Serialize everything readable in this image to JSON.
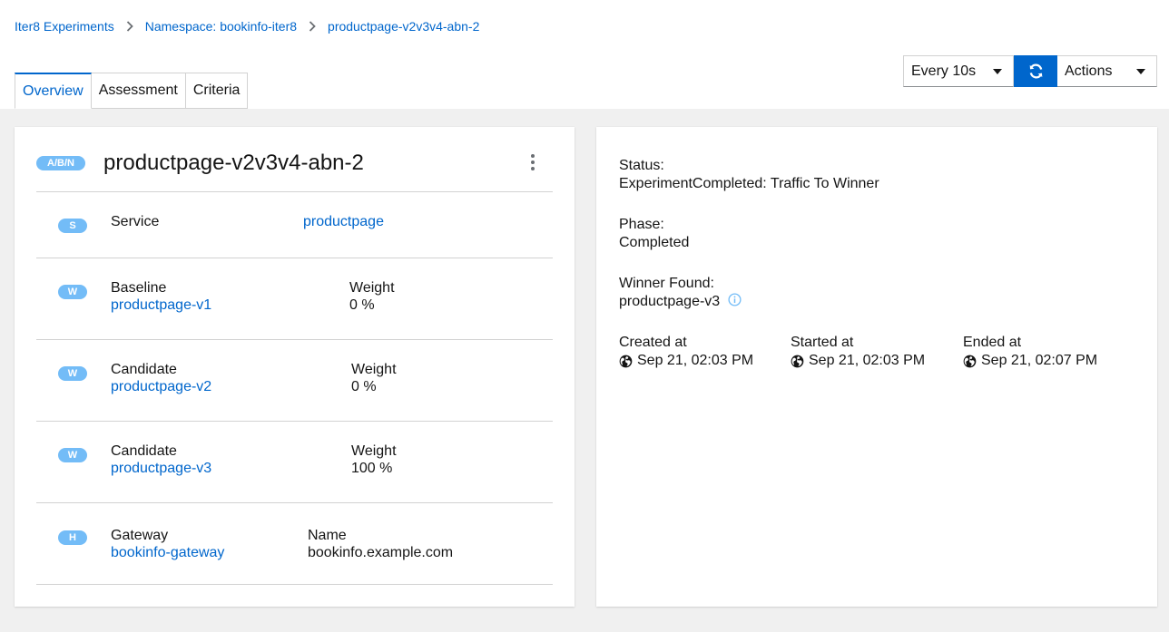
{
  "breadcrumb": [
    "Iter8 Experiments",
    "Namespace: bookinfo-iter8",
    "productpage-v2v3v4-abn-2"
  ],
  "tabs": [
    "Overview",
    "Assessment",
    "Criteria"
  ],
  "toolbar": {
    "interval": "Every 10s",
    "actions": "Actions"
  },
  "experiment": {
    "type_badge": "A/B/N",
    "name": "productpage-v2v3v4-abn-2",
    "service": {
      "badge": "S",
      "label": "Service",
      "value": "productpage"
    },
    "baseline": {
      "badge": "W",
      "label": "Baseline",
      "name": "productpage-v1",
      "weight_label": "Weight",
      "weight": "0 %"
    },
    "candidates": [
      {
        "badge": "W",
        "label": "Candidate",
        "name": "productpage-v2",
        "weight_label": "Weight",
        "weight": "0 %"
      },
      {
        "badge": "W",
        "label": "Candidate",
        "name": "productpage-v3",
        "weight_label": "Weight",
        "weight": "100 %"
      }
    ],
    "gateway": {
      "badge": "H",
      "label": "Gateway",
      "name": "bookinfo-gateway",
      "host_label": "Name",
      "host": "bookinfo.example.com"
    }
  },
  "status": {
    "status_label": "Status:",
    "status_value": "ExperimentCompleted: Traffic To Winner",
    "phase_label": "Phase:",
    "phase_value": "Completed",
    "winner_label": "Winner Found:",
    "winner_value": "productpage-v3",
    "created_label": "Created at",
    "created_value": "Sep 21, 02:03 PM",
    "started_label": "Started at",
    "started_value": "Sep 21, 02:03 PM",
    "ended_label": "Ended at",
    "ended_value": "Sep 21, 02:07 PM"
  },
  "colors": {
    "accent": "#0066cc",
    "badge": "#73bcf7",
    "info_icon": "#73bcf7"
  },
  "icons": [
    "chevron-right-icon",
    "caret-down-icon",
    "sync-icon",
    "kebab-icon",
    "globe-icon",
    "info-circle-icon"
  ]
}
